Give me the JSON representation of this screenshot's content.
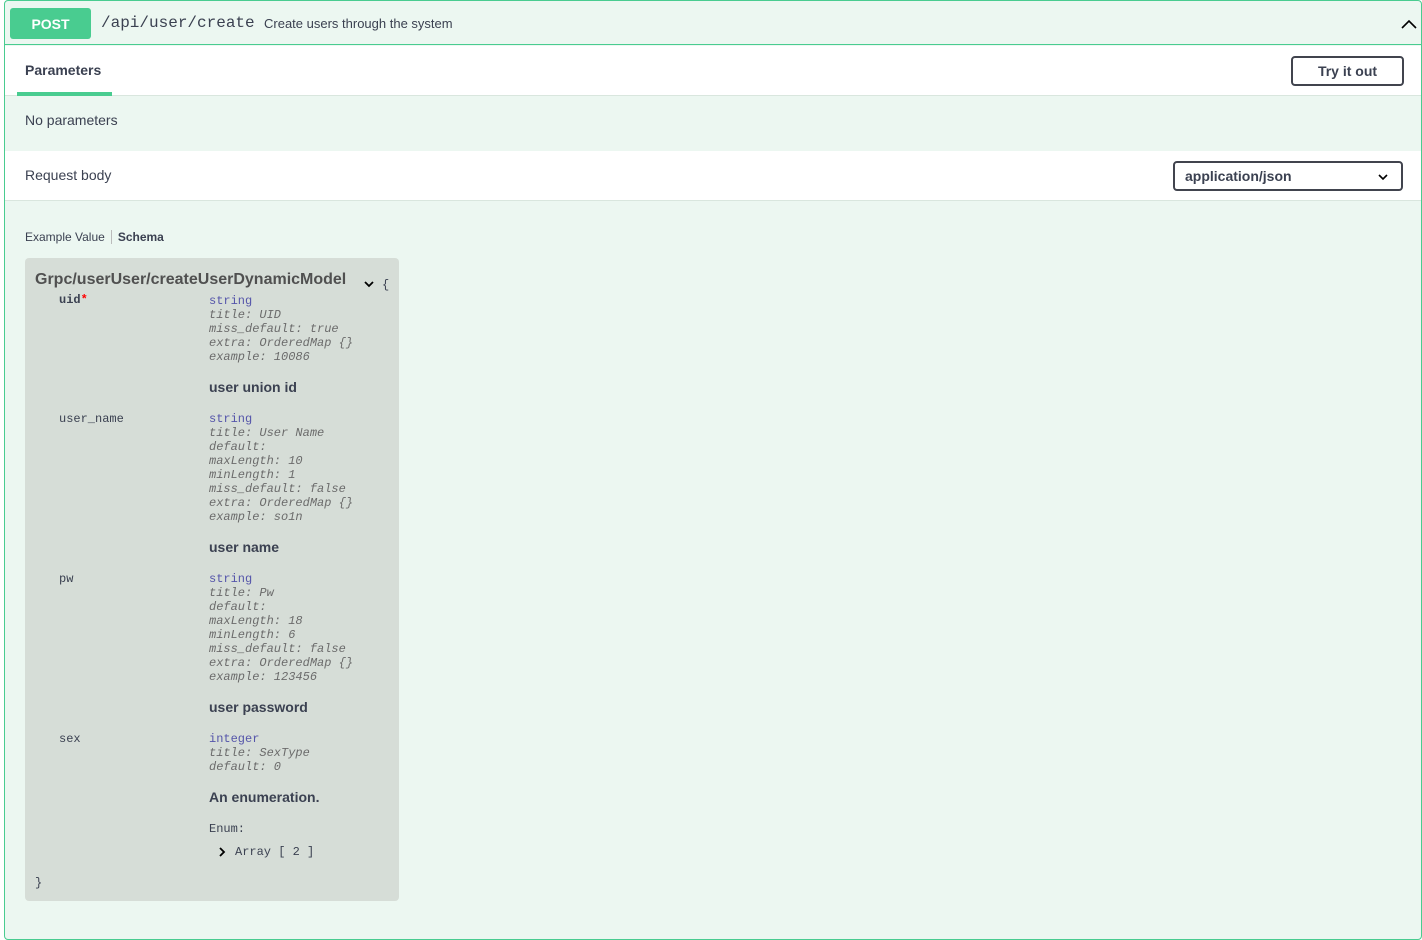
{
  "operation": {
    "method": "POST",
    "path": "/api/user/create",
    "summary": "Create users through the system"
  },
  "tabs": {
    "parameters": "Parameters",
    "try_it_out": "Try it out",
    "no_parameters": "No parameters"
  },
  "request_body": {
    "label": "Request body",
    "content_type": "application/json"
  },
  "model_tabs": {
    "example": "Example Value",
    "schema": "Schema"
  },
  "model": {
    "name": "Grpc/userUser/createUserDynamicModel",
    "brace_open": "{",
    "brace_close": "}",
    "properties": [
      {
        "name": "uid",
        "required_mark": "*",
        "type": "string",
        "meta": [
          "title: UID",
          "miss_default: true",
          "extra: OrderedMap {}",
          "example: 10086"
        ],
        "description": "user union id"
      },
      {
        "name": "user_name",
        "type": "string",
        "meta": [
          "title: User Name",
          "default:",
          "maxLength: 10",
          "minLength: 1",
          "miss_default: false",
          "extra: OrderedMap {}",
          "example: so1n"
        ],
        "description": "user name"
      },
      {
        "name": "pw",
        "type": "string",
        "meta": [
          "title: Pw",
          "default:",
          "maxLength: 18",
          "minLength: 6",
          "miss_default: false",
          "extra: OrderedMap {}",
          "example: 123456"
        ],
        "description": "user password"
      },
      {
        "name": "sex",
        "type": "integer",
        "meta": [
          "title: SexType",
          "default: 0"
        ],
        "description": "An enumeration."
      }
    ],
    "enum_label": "Enum:",
    "enum_array": "Array [ 2 ]"
  },
  "colors": {
    "method_post": "#49cc90",
    "block_bg": "#ecf7f1",
    "model_bg": "#d6ddd7",
    "required": "#ff0000",
    "type_text": "#5555aa"
  },
  "icons": {
    "collapse": "chevron-up-icon",
    "select": "chevron-down-icon",
    "model_toggle": "chevron-down-icon",
    "enum_expand": "chevron-right-icon"
  }
}
